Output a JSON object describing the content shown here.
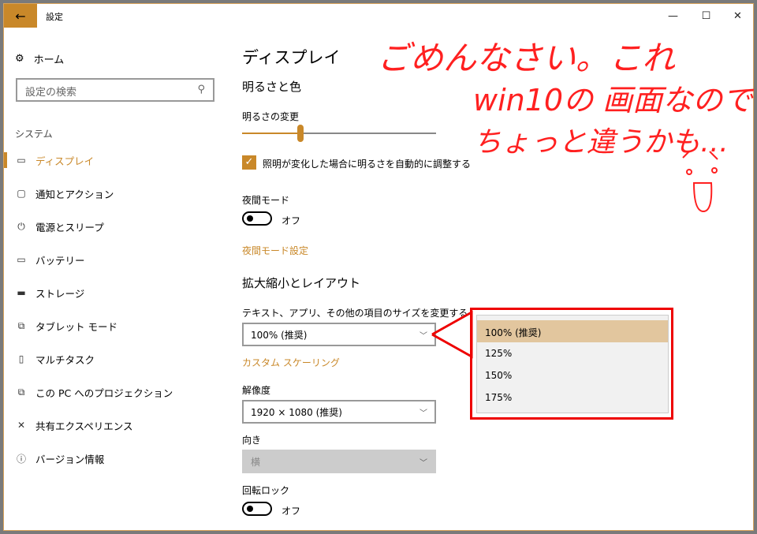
{
  "window": {
    "title": "設定",
    "back": "←",
    "minimize": "—",
    "maximize": "☐",
    "close": "✕"
  },
  "sidebar": {
    "home": "ホーム",
    "search_placeholder": "設定の検索",
    "section": "システム",
    "items": [
      {
        "label": "ディスプレイ",
        "icon": "▭"
      },
      {
        "label": "通知とアクション",
        "icon": "▢"
      },
      {
        "label": "電源とスリープ",
        "icon": "⏻"
      },
      {
        "label": "バッテリー",
        "icon": "▭"
      },
      {
        "label": "ストレージ",
        "icon": "▬"
      },
      {
        "label": "タブレット モード",
        "icon": "⧉"
      },
      {
        "label": "マルチタスク",
        "icon": "▯"
      },
      {
        "label": "この PC へのプロジェクション",
        "icon": "⧉"
      },
      {
        "label": "共有エクスペリエンス",
        "icon": "✕"
      },
      {
        "label": "バージョン情報",
        "icon": "ⓘ"
      }
    ]
  },
  "main": {
    "title": "ディスプレイ",
    "brightness_heading": "明るさと色",
    "brightness_label": "明るさの変更",
    "brightness_value": 30,
    "auto_brightness": "照明が変化した場合に明るさを自動的に調整する",
    "night_mode": "夜間モード",
    "night_state": "オフ",
    "night_settings": "夜間モード設定",
    "scale_heading": "拡大縮小とレイアウト",
    "scale_label": "テキスト、アプリ、その他の項目のサイズを変更する",
    "scale_value": "100% (推奨)",
    "custom_scaling": "カスタム スケーリング",
    "resolution_label": "解像度",
    "resolution_value": "1920 × 1080 (推奨)",
    "orientation_label": "向き",
    "orientation_value": "横",
    "rotation_lock": "回転ロック",
    "rotation_state": "オフ"
  },
  "dropdown": {
    "options": [
      "100% (推奨)",
      "125%",
      "150%",
      "175%"
    ]
  },
  "annotation": {
    "line1": "ごめんなさい。これ",
    "line2": "win10の 画面なので",
    "line3": "ちょっと違うかも…",
    "color": "#ff2020"
  }
}
